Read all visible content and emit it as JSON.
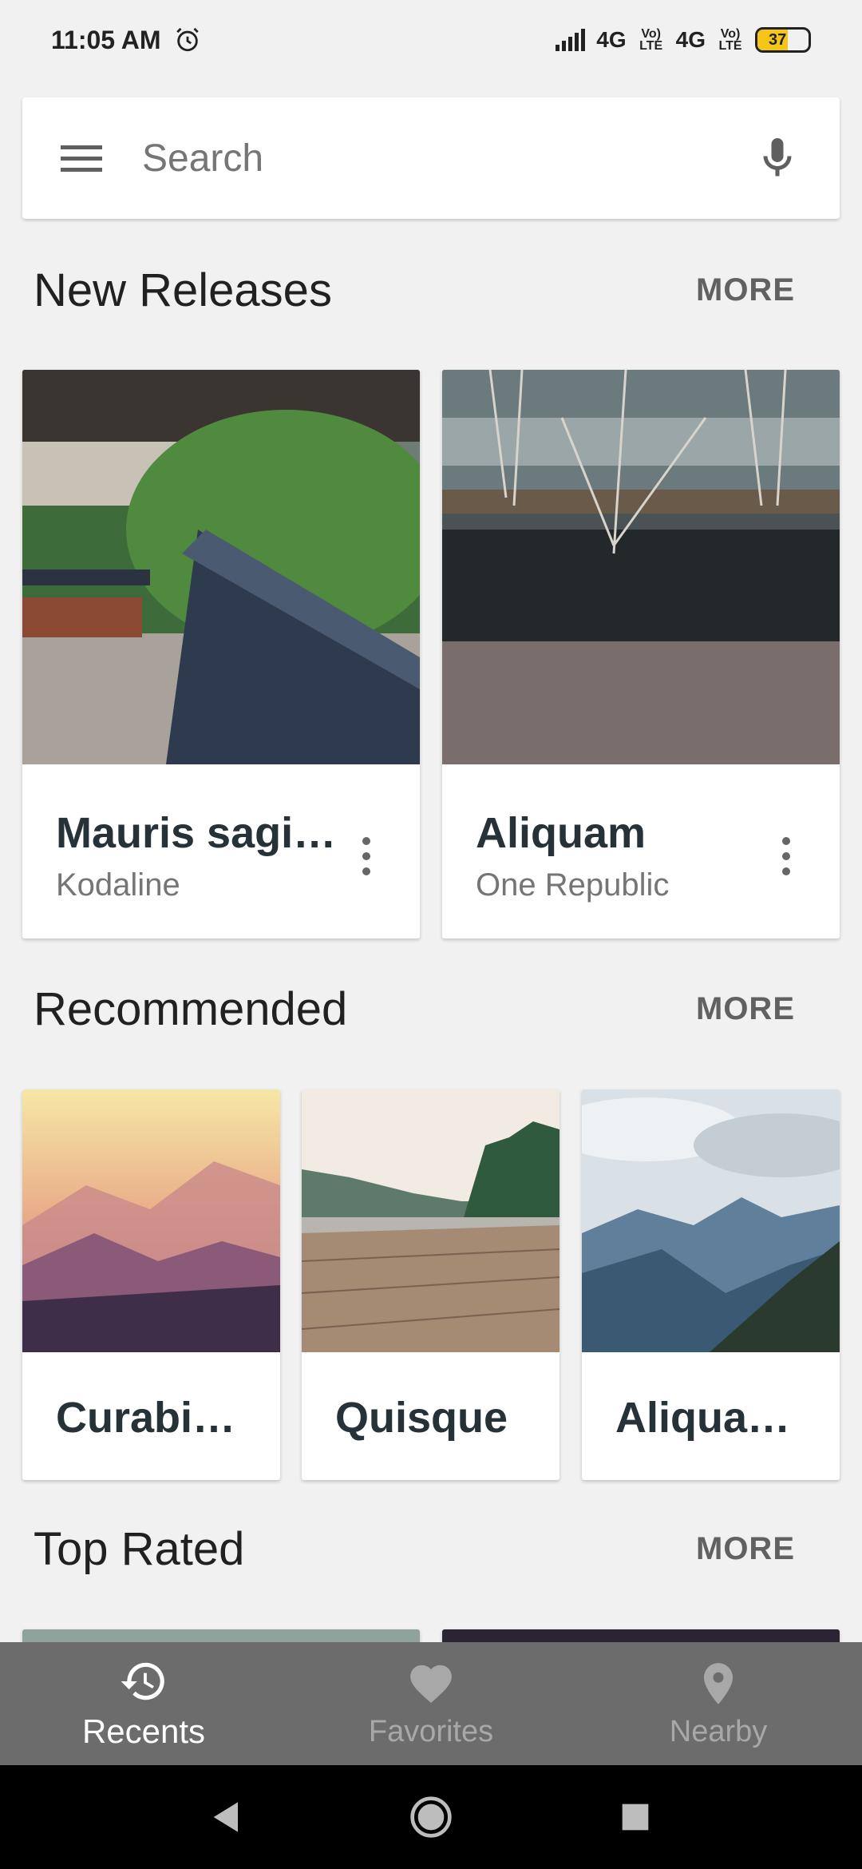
{
  "status_bar": {
    "time": "11:05 AM",
    "network_1": "4G",
    "volte_1": "Vo) LTE",
    "network_2": "4G",
    "volte_2": "Vo) LTE",
    "battery": "37"
  },
  "search": {
    "placeholder": "Search"
  },
  "new_releases": {
    "title": "New Releases",
    "more": "MORE",
    "cards": [
      {
        "title": "Mauris sagi…",
        "subtitle": "Kodaline"
      },
      {
        "title": "Aliquam",
        "subtitle": "One Republic"
      }
    ]
  },
  "recommended": {
    "title": "Recommended",
    "more": "MORE",
    "cards": [
      {
        "title": "Curabit…"
      },
      {
        "title": "Quisque"
      },
      {
        "title": "Aliqua…"
      }
    ]
  },
  "top_rated": {
    "title": "Top Rated",
    "more": "MORE"
  },
  "bottom_nav": {
    "items": [
      {
        "label": "Recents",
        "icon": "history-icon",
        "active": true
      },
      {
        "label": "Favorites",
        "icon": "heart-icon",
        "active": false
      },
      {
        "label": "Nearby",
        "icon": "location-pin-icon",
        "active": false
      }
    ]
  },
  "colors": {
    "background": "#f1f1f1",
    "bottom_nav": "#6c6c6c",
    "title_text": "#263238",
    "more_text": "#616161"
  }
}
